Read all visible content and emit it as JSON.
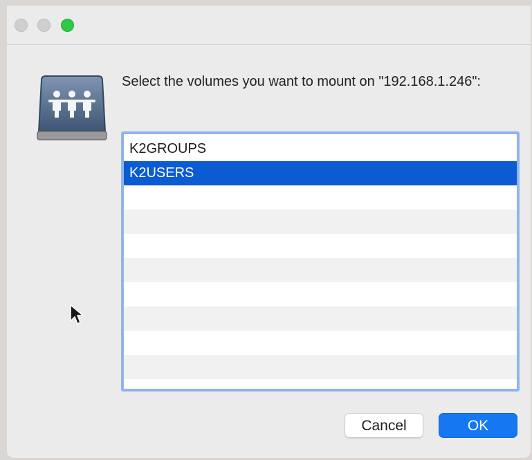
{
  "window": {
    "traffic_lights": [
      {
        "name": "close",
        "color": "#cfcfcf"
      },
      {
        "name": "minimize",
        "color": "#cfcfcf"
      },
      {
        "name": "zoom",
        "color": "#2ec946"
      }
    ]
  },
  "dialog": {
    "icon": "shared-server-icon",
    "prompt": "Select the volumes you want to mount on \"192.168.1.246\":",
    "volumes": [
      {
        "label": "K2GROUPS",
        "selected": false
      },
      {
        "label": "K2USERS",
        "selected": true
      }
    ],
    "empty_rows": 8
  },
  "buttons": {
    "cancel_label": "Cancel",
    "ok_label": "OK"
  },
  "colors": {
    "selection": "#0b5bd3",
    "primary_button": "#1677f2",
    "listbox_focus_ring": "#8fb4ee"
  }
}
